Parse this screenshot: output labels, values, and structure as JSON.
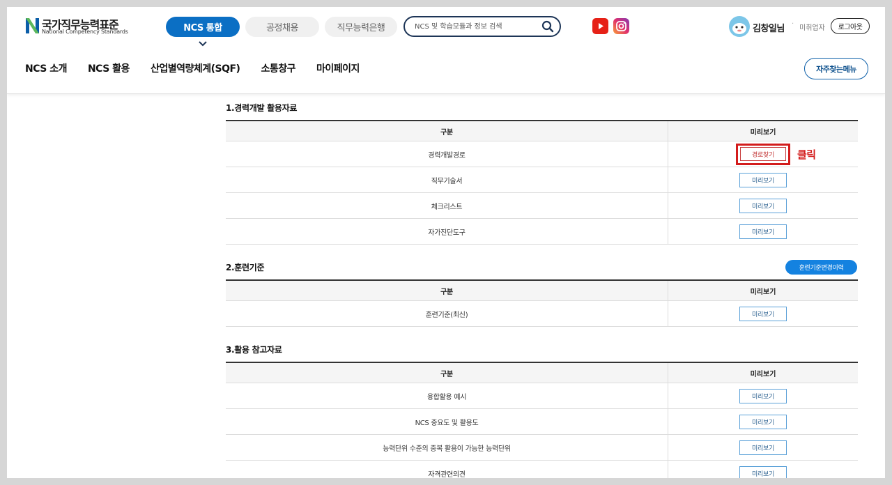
{
  "logo": {
    "title": "국가직무능력표준",
    "subtitle": "National Competency Standards"
  },
  "top_tabs": [
    {
      "label": "NCS 통합"
    },
    {
      "label": "공정채용"
    },
    {
      "label": "직무능력은행"
    }
  ],
  "search": {
    "placeholder": "NCS 및 학습모듈과 정보 검색"
  },
  "social": {
    "youtube": "youtube-icon",
    "instagram": "instagram-icon"
  },
  "user": {
    "name": "김창일님",
    "separator": "·",
    "status": "미취업자",
    "logout_label": "로그아웃"
  },
  "nav": {
    "items": [
      {
        "label": "NCS 소개"
      },
      {
        "label": "NCS 활용"
      },
      {
        "label": "산업별역량체계(SQF)"
      },
      {
        "label": "소통창구"
      },
      {
        "label": "마이페이지"
      }
    ],
    "favorites_label": "자주찾는메뉴"
  },
  "sections": [
    {
      "title": "1.경력개발 활용자료",
      "headers": [
        "구분",
        "미리보기"
      ],
      "rows": [
        {
          "name": "경력개발경로",
          "button": "경로찾기"
        },
        {
          "name": "직무기술서",
          "button": "미리보기"
        },
        {
          "name": "체크리스트",
          "button": "미리보기"
        },
        {
          "name": "자가진단도구",
          "button": "미리보기"
        }
      ]
    },
    {
      "title": "2.훈련기준",
      "action_label": "훈련기준변경이력",
      "headers": [
        "구분",
        "미리보기"
      ],
      "rows": [
        {
          "name": "훈련기준(최신)",
          "button": "미리보기"
        }
      ]
    },
    {
      "title": "3.활용 참고자료",
      "headers": [
        "구분",
        "미리보기"
      ],
      "rows": [
        {
          "name": "융합활용 예시",
          "button": "미리보기"
        },
        {
          "name": "NCS 중요도 및 활용도",
          "button": "미리보기"
        },
        {
          "name": "능력단위 수준의 중복 활용이 가능한 능력단위",
          "button": "미리보기"
        },
        {
          "name": "자격관련의견",
          "button": "미리보기"
        }
      ]
    }
  ],
  "annotation": {
    "text": "클릭",
    "color": "#d31c1c"
  },
  "colors": {
    "primary": "#0b6fc4",
    "navy": "#1d3557",
    "highlight": "#d31c1c"
  }
}
